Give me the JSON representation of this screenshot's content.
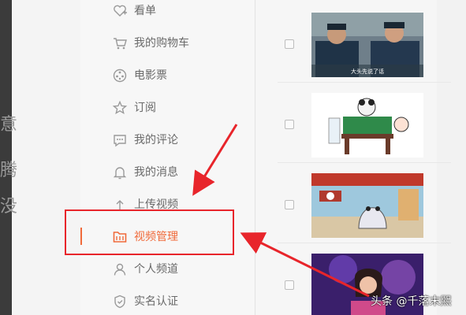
{
  "background": {
    "fragments": [
      "意",
      "腾",
      "没"
    ]
  },
  "sidebar": {
    "items": [
      {
        "label": "看单",
        "icon": "heart-plus-icon"
      },
      {
        "label": "我的购物车",
        "icon": "cart-icon"
      },
      {
        "label": "电影票",
        "icon": "film-reel-icon"
      },
      {
        "label": "订阅",
        "icon": "star-icon"
      },
      {
        "label": "我的评论",
        "icon": "comment-icon"
      },
      {
        "label": "我的消息",
        "icon": "bell-icon"
      },
      {
        "label": "上传视频",
        "icon": "upload-icon"
      },
      {
        "label": "视频管理",
        "icon": "folder-video-icon",
        "active": true
      },
      {
        "label": "个人频道",
        "icon": "person-icon"
      },
      {
        "label": "实名认证",
        "icon": "shield-icon"
      }
    ]
  },
  "videos": [
    {
      "caption": "大头先说了话"
    },
    {
      "caption": ""
    },
    {
      "caption": ""
    },
    {
      "caption": ""
    }
  ],
  "watermark": "头条 @千落末熙",
  "colors": {
    "accent": "#f06a3a",
    "highlight": "#e8252b",
    "arrow": "#e8252b"
  }
}
